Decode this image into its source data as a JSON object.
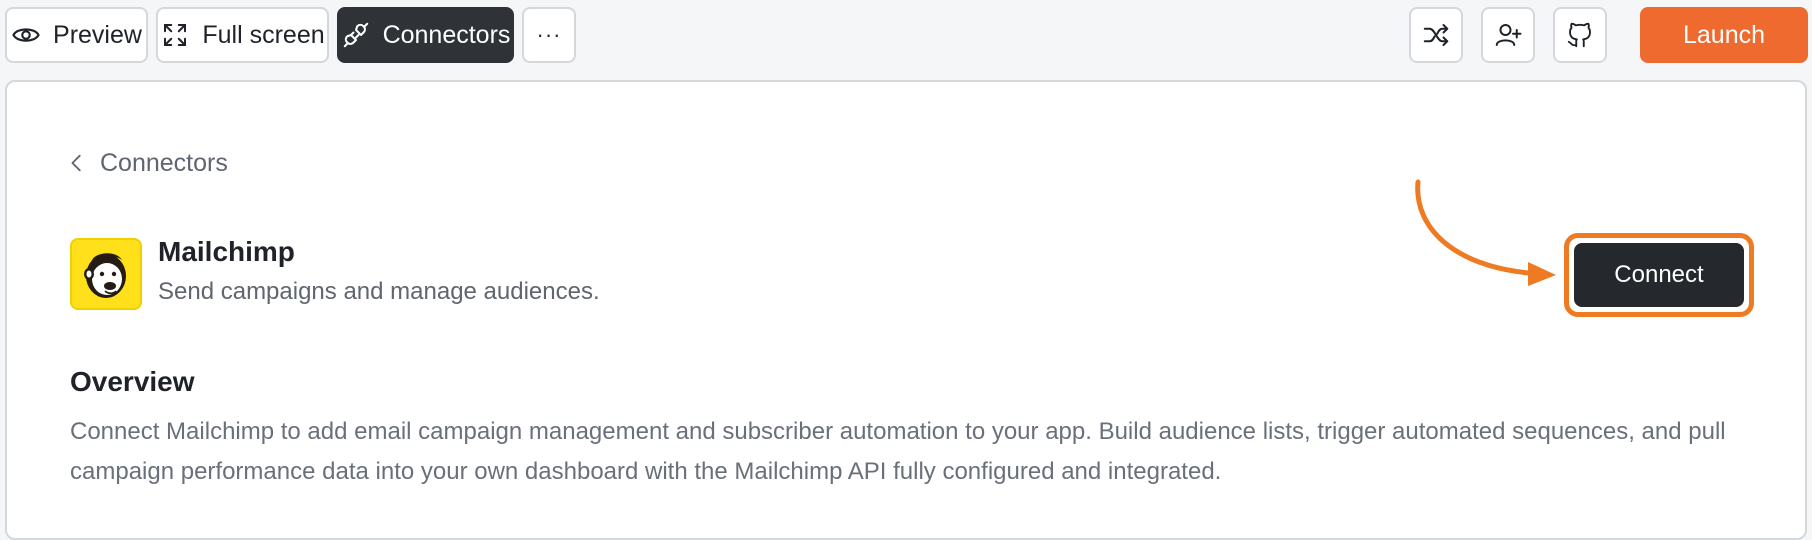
{
  "toolbar": {
    "preview_label": "Preview",
    "fullscreen_label": "Full screen",
    "connectors_label": "Connectors",
    "more_label": "···",
    "launch_label": "Launch"
  },
  "breadcrumb": {
    "back_label": "Connectors"
  },
  "connector": {
    "name": "Mailchimp",
    "description": "Send campaigns and manage audiences.",
    "connect_label": "Connect",
    "logo_icon": "mailchimp-logo-icon"
  },
  "overview": {
    "heading": "Overview",
    "text": "Connect Mailchimp to add email campaign management and subscriber automation to your app. Build audience lists, trigger automated sequences, and pull campaign performance data into your own dashboard with the Mailchimp API fully configured and integrated."
  },
  "colors": {
    "accent": "#ee6a2f",
    "highlight": "#ee7a22",
    "dark_button": "#25292d",
    "mailchimp_yellow": "#ffe01b"
  }
}
